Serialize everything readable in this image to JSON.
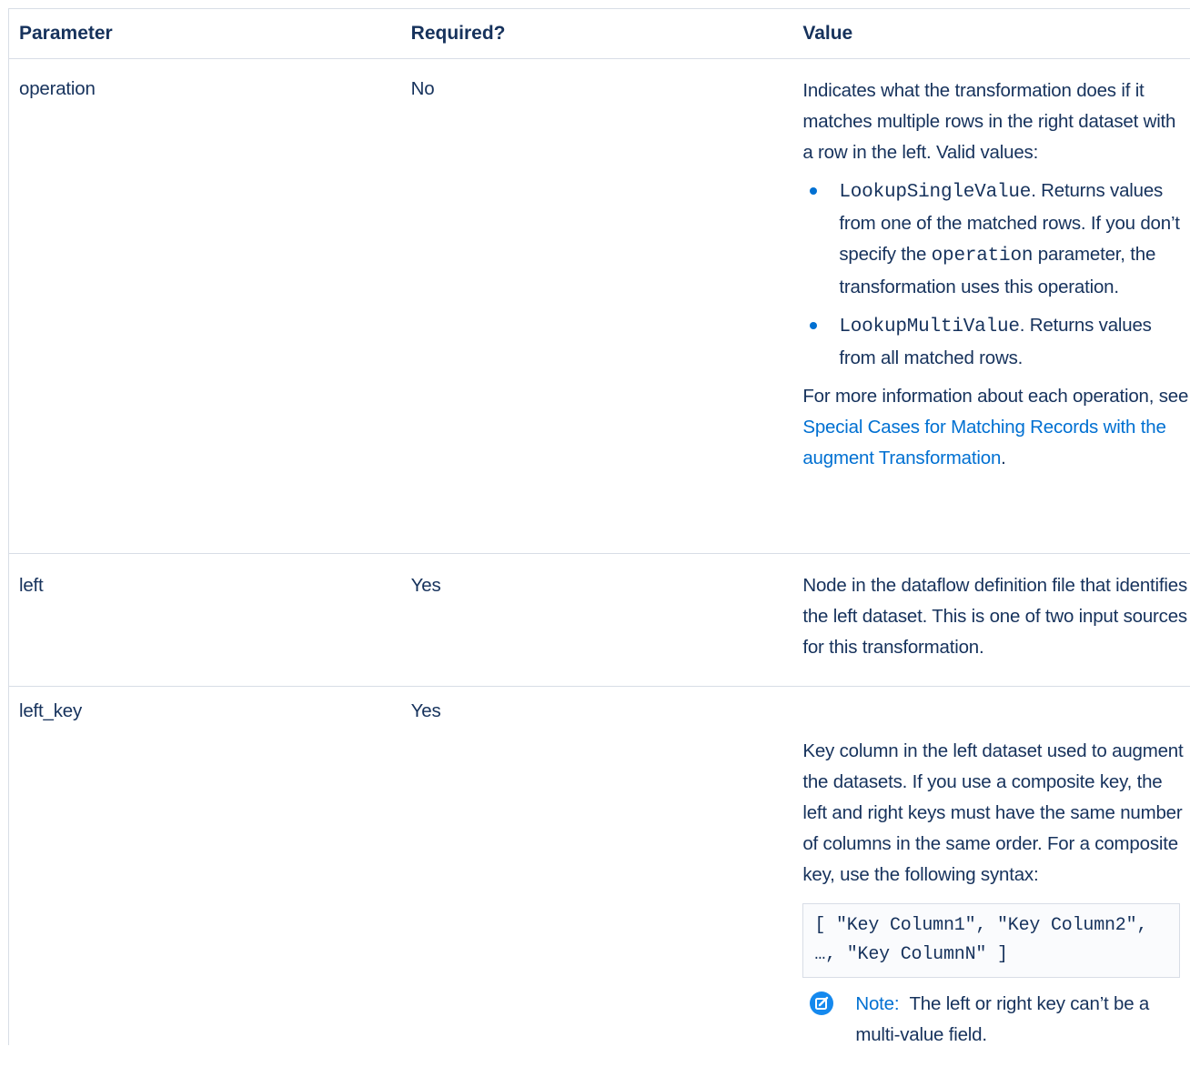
{
  "table": {
    "headers": [
      "Parameter",
      "Required?",
      "Value"
    ],
    "rows": [
      {
        "parameter": "operation",
        "required": "No",
        "value_intro": "Indicates what the transformation does if it matches multiple rows in the right dataset with a row in the left. Valid values:",
        "bullets": [
          {
            "code": "LookupSingleValue",
            "text_a": ". Returns values from one of the matched rows. If you don’t specify the ",
            "code2": "operation",
            "text_b": " parameter, the transformation uses this operation."
          },
          {
            "code": "LookupMultiValue",
            "text_a": ". Returns values from all matched rows."
          }
        ],
        "more_prefix": "For more information about each operation, see ",
        "more_link": "Special Cases for Matching Records with the augment Transformation",
        "more_suffix": "."
      },
      {
        "parameter": "left",
        "required": "Yes",
        "value": "Node in the dataflow definition file that identifies the left dataset. This is one of two input sources for this transformation."
      },
      {
        "parameter": "left_key",
        "required": "Yes",
        "value_intro": "Key column in the left dataset used to augment the datasets. If you use a composite key, the left and right keys must have the same number of columns in the same order. For a composite key, use the following syntax:",
        "code_block": "[ \"Key Column1\", \"Key Column2\", …, \"Key ColumnN\" ]",
        "note_label": "Note:",
        "note_text": "The left or right key can’t be a multi-value field."
      }
    ]
  },
  "colors": {
    "text": "#16325c",
    "link": "#0070d2",
    "bullet": "#0070d2",
    "border": "#d8dde6"
  },
  "icons": {
    "bullet": "bullet-dot-icon",
    "note": "edit-note-icon"
  }
}
